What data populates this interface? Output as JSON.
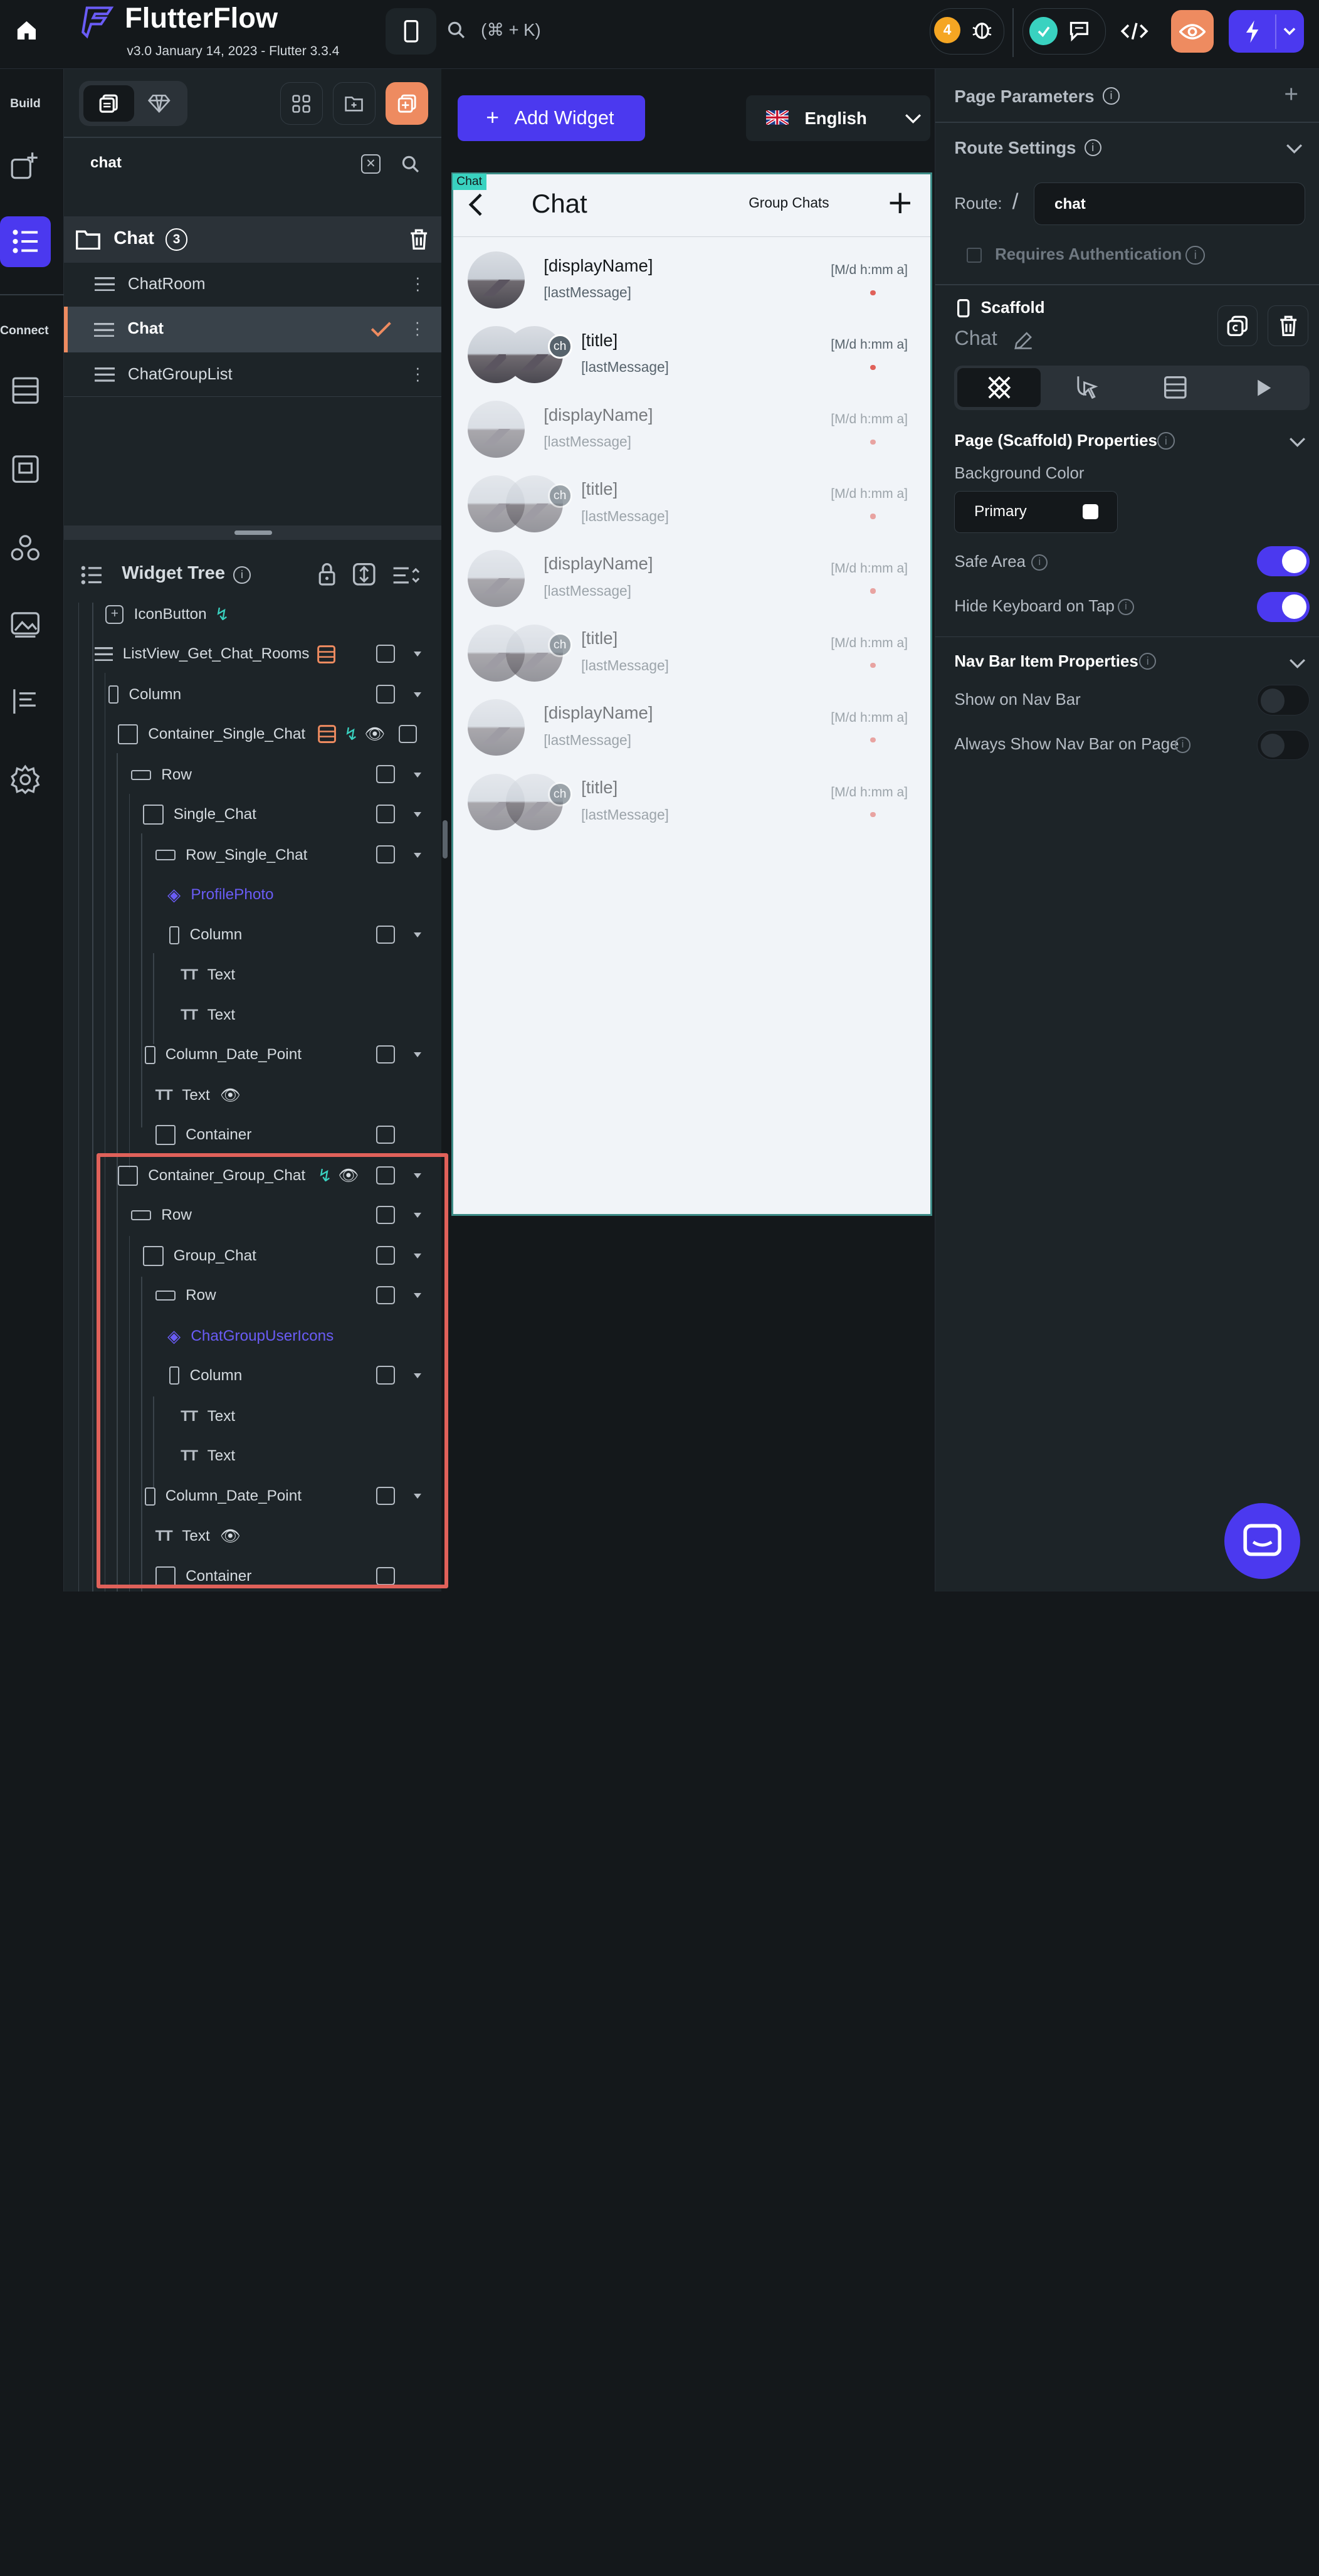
{
  "app": {
    "name": "FlutterFlow",
    "version": "v3.0 January 14, 2023 - Flutter 3.3.4",
    "search_shortcut": "(⌘ + K)",
    "badge_count": "4"
  },
  "rail": {
    "build_label": "Build",
    "connect_label": "Connect"
  },
  "leftpanel": {
    "search_value": "chat",
    "folder": {
      "name": "Chat",
      "count": "3"
    },
    "pages": [
      {
        "name": "ChatRoom"
      },
      {
        "name": "Chat"
      },
      {
        "name": "ChatGroupList"
      }
    ],
    "widget_tree_title": "Widget Tree",
    "tree": [
      {
        "label": "IconButton"
      },
      {
        "label": "ListView_Get_Chat_Rooms"
      },
      {
        "label": "Column"
      },
      {
        "label": "Container_Single_Chat"
      },
      {
        "label": "Row"
      },
      {
        "label": "Single_Chat"
      },
      {
        "label": "Row_Single_Chat"
      },
      {
        "label": "ProfilePhoto"
      },
      {
        "label": "Column"
      },
      {
        "label": "Text"
      },
      {
        "label": "Text"
      },
      {
        "label": "Column_Date_Point"
      },
      {
        "label": "Text"
      },
      {
        "label": "Container"
      },
      {
        "label": "Container_Group_Chat"
      },
      {
        "label": "Row"
      },
      {
        "label": "Group_Chat"
      },
      {
        "label": "Row"
      },
      {
        "label": "ChatGroupUserIcons"
      },
      {
        "label": "Column"
      },
      {
        "label": "Text"
      },
      {
        "label": "Text"
      },
      {
        "label": "Column_Date_Point"
      },
      {
        "label": "Text"
      },
      {
        "label": "Container"
      }
    ]
  },
  "canvas": {
    "add_widget_label": "Add Widget",
    "language": "English",
    "page_tag": "Chat",
    "page_title": "Chat",
    "group_chats_label": "Group Chats",
    "chat_items": [
      {
        "title": "[displayName]",
        "subtitle": "[lastMessage]",
        "time": "[M/d h:mm a]",
        "group": false
      },
      {
        "title": "[title]",
        "subtitle": "[lastMessage]",
        "time": "[M/d h:mm a]",
        "group": true,
        "badge": "ch"
      },
      {
        "title": "[displayName]",
        "subtitle": "[lastMessage]",
        "time": "[M/d h:mm a]",
        "group": false
      },
      {
        "title": "[title]",
        "subtitle": "[lastMessage]",
        "time": "[M/d h:mm a]",
        "group": true,
        "badge": "ch"
      },
      {
        "title": "[displayName]",
        "subtitle": "[lastMessage]",
        "time": "[M/d h:mm a]",
        "group": false
      },
      {
        "title": "[title]",
        "subtitle": "[lastMessage]",
        "time": "[M/d h:mm a]",
        "group": true,
        "badge": "ch"
      },
      {
        "title": "[displayName]",
        "subtitle": "[lastMessage]",
        "time": "[M/d h:mm a]",
        "group": false
      },
      {
        "title": "[title]",
        "subtitle": "[lastMessage]",
        "time": "[M/d h:mm a]",
        "group": true,
        "badge": "ch"
      }
    ]
  },
  "rightpanel": {
    "page_parameters": "Page Parameters",
    "route_settings": "Route Settings",
    "route_label": "Route:",
    "route_slash": "/",
    "route_value": "chat",
    "requires_auth": "Requires Authentication",
    "scaffold_label": "Scaffold",
    "scaffold_name": "Chat",
    "scaffold_props": "Page (Scaffold) Properties",
    "background_color_label": "Background Color",
    "background_color_value": "Primary",
    "safe_area": "Safe Area",
    "safe_area_on": true,
    "hide_keyboard": "Hide Keyboard on Tap",
    "hide_keyboard_on": true,
    "nav_bar_props": "Nav Bar Item Properties",
    "show_on_nav_bar": "Show on Nav Bar",
    "show_on_nav_bar_on": false,
    "always_show_nav": "Always Show Nav Bar on Page",
    "always_show_nav_on": false
  },
  "colors": {
    "accent": "#4b39ef",
    "orange": "#ee8b60",
    "green": "#39d2c0",
    "highlight_border": "#e0615a"
  }
}
